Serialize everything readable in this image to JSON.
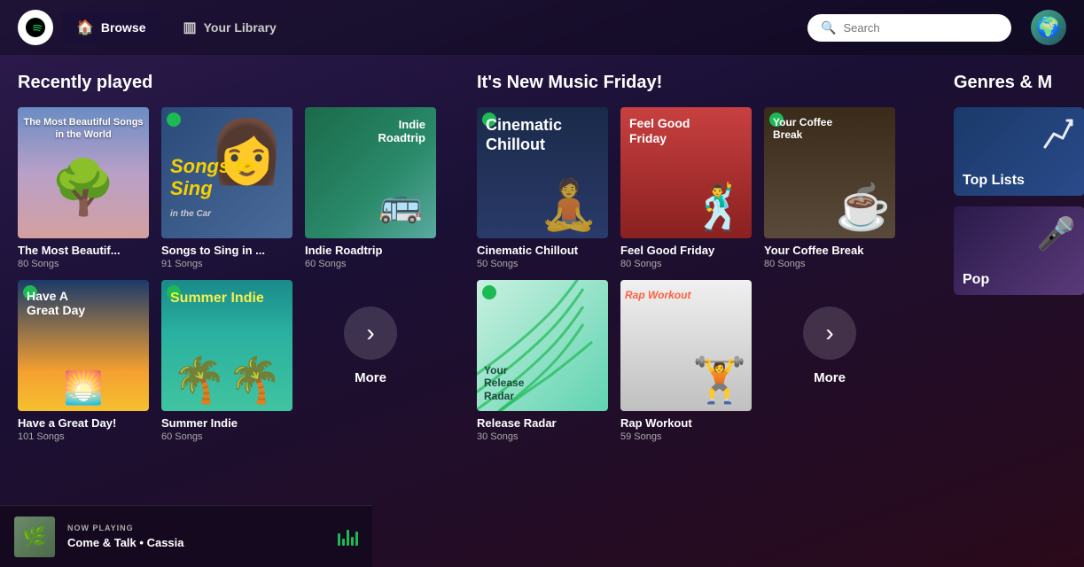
{
  "nav": {
    "browse_label": "Browse",
    "library_label": "Your Library",
    "search_placeholder": "Search"
  },
  "recently_played": {
    "title": "Recently played",
    "items": [
      {
        "title": "The Most Beautif...",
        "sub": "80 Songs",
        "bg": "beautiful-songs",
        "overlay_text": "The Most Beautiful Songs\nin the World"
      },
      {
        "title": "Songs to Sing in ...",
        "sub": "91 Songs",
        "bg": "sing-car"
      },
      {
        "title": "Indie Roadtrip",
        "sub": "60 Songs",
        "bg": "indie-roadtrip"
      },
      {
        "title": "Have a Great Day!",
        "sub": "101 Songs",
        "bg": "have-great-day"
      },
      {
        "title": "Summer Indie",
        "sub": "60 Songs",
        "bg": "summer-indie"
      },
      {
        "title": "More",
        "sub": "",
        "bg": "more"
      }
    ]
  },
  "new_music": {
    "title": "It's New Music Friday!",
    "items": [
      {
        "title": "Cinematic Chillout",
        "sub": "50 Songs",
        "bg": "cinematic"
      },
      {
        "title": "Feel Good Friday",
        "sub": "80 Songs",
        "bg": "feel-good"
      },
      {
        "title": "Your Coffee Break",
        "sub": "80 Songs",
        "bg": "coffee"
      },
      {
        "title": "Release Radar",
        "sub": "30 Songs",
        "bg": "release-radar"
      },
      {
        "title": "Rap Workout",
        "sub": "59 Songs",
        "bg": "rap-workout"
      },
      {
        "title": "More",
        "sub": "",
        "bg": "more"
      }
    ]
  },
  "genres": {
    "title": "Genres & M",
    "items": [
      {
        "title": "Top Lists",
        "bg": "top-lists"
      },
      {
        "title": "Pop",
        "bg": "pop"
      }
    ]
  },
  "now_playing": {
    "label": "NOW PLAYING",
    "song": "Come & Talk",
    "separator": "•",
    "artist": "Cassia"
  }
}
